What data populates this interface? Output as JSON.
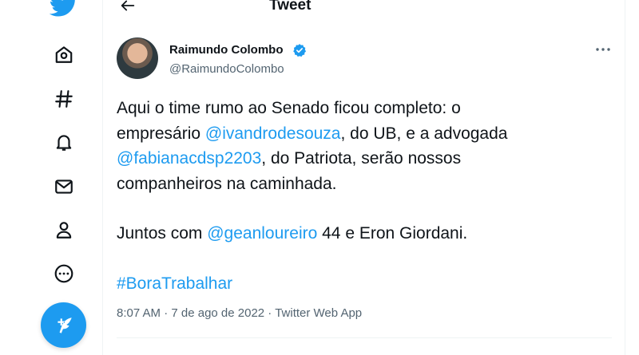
{
  "header": {
    "title": "Tweet"
  },
  "nav": {
    "icons": [
      "twitter-logo",
      "home-icon",
      "explore-icon",
      "notifications-icon",
      "messages-icon",
      "profile-icon",
      "more-icon"
    ],
    "accent": "#1d9bf0"
  },
  "tweet": {
    "author": {
      "name": "Raimundo Colombo",
      "handle": "@RaimundoColombo",
      "verified": true
    },
    "lines": [
      {
        "t1": "Aqui o time rumo ao Senado ficou completo: o"
      },
      {
        "t1": "empresário ",
        "m1": "@ivandrodesouza",
        "t2": ", do UB, e a advogada"
      },
      {
        "m1": "@fabianacdsp2203",
        "t2": ", do Patriota, serão nossos"
      },
      {
        "t1": "companheiros na caminhada."
      },
      {
        "t1": "Juntos com ",
        "m1": "@geanloureiro",
        "t2": " 44 e Eron Giordani."
      }
    ],
    "hashtag": "#BoraTrabalhar",
    "meta": "8:07 AM · 7 de ago de 2022 · Twitter Web App"
  }
}
